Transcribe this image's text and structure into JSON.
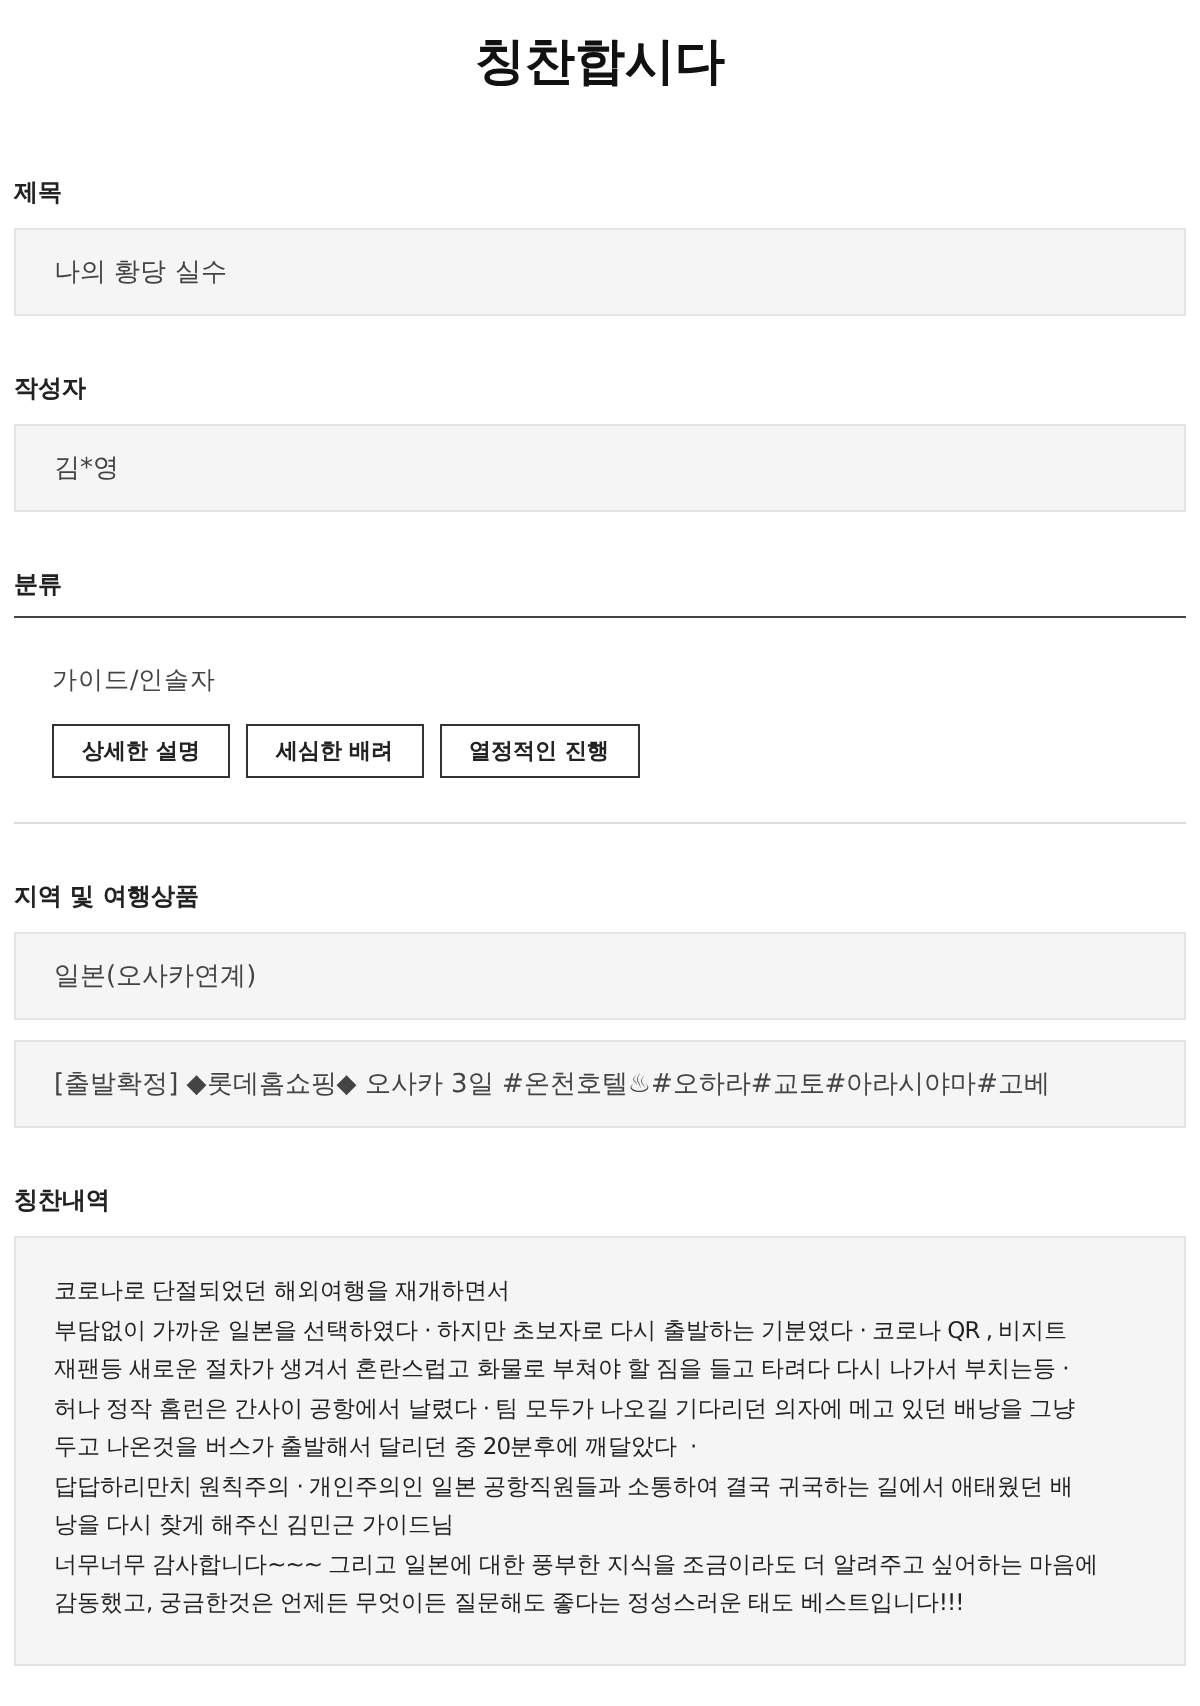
{
  "page_title": "칭찬합시다",
  "fields": [
    {
      "label": "제목",
      "value": "나의 황당 실수"
    },
    {
      "label": "작성자",
      "value": "김*영"
    }
  ],
  "category": {
    "label": "분류",
    "group": "가이드/인솔자",
    "tags": [
      "상세한 설명",
      "세심한 배려",
      "열정적인 진행"
    ]
  },
  "region": {
    "label": "지역 및 여행상품",
    "values": [
      "일본(오사카연계)",
      "[출발확정] ◆롯데홈쇼핑◆ 오사카 3일 #온천호텔♨#오하라#교토#아라시야마#고베"
    ]
  },
  "praise": {
    "label": "칭찬내역",
    "text": "코로나로 단절되었던 해외여행을 재개하면서\n부담없이 가까운 일본을 선택하였다 · 하지만 초보자로 다시 출발하는 기분였다 · 코로나 QR , 비지트\n재팬등 새로운 절차가 생겨서 혼란스럽고 화물로 부쳐야 할 짐을 들고 타려다 다시 나가서 부치는등 ·\n허나 정작 홈런은 간사이 공항에서 날렸다 · 팀 모두가 나오길 기다리던 의자에 메고 있던 배낭을 그냥\n두고 나온것을 버스가 출발해서 달리던 중 20분후에 깨달았다  ·\n답답하리만치 원칙주의 · 개인주의인 일본 공항직원들과 소통하여 결국 귀국하는 길에서 애태웠던 배\n낭을 다시 찾게 해주신 김민근 가이드님\n너무너무 감사합니다~~~ 그리고 일본에 대한 풍부한 지식을 조금이라도 더 알려주고 싶어하는 마음에\n감동했고, 궁금한것은 언제든 무엇이든 질문해도 좋다는 정성스러운 태도 베스트입니다!!!"
  }
}
